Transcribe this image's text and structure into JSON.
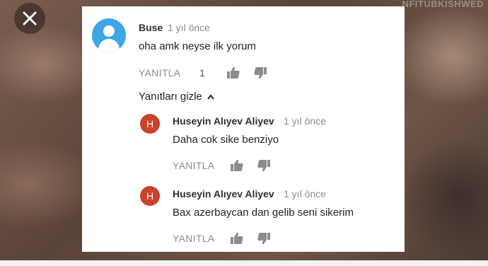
{
  "overlay": {
    "watermark_text": "NFITUBKISHWED"
  },
  "comment": {
    "author": "Buse",
    "time": "1 yıl önce",
    "text": "oha amk neyse ilk yorum",
    "reply_label": "YANITLA",
    "like_count": "1",
    "avatar_color": "#3ea6e6"
  },
  "hide_replies_label": "Yanıtları gizle",
  "replies": [
    {
      "avatar_letter": "H",
      "author": "Huseyin Alıyev Aliyev",
      "time": "1 yıl önce",
      "text": "Daha cok sike benziyo",
      "reply_label": "YANITLA"
    },
    {
      "avatar_letter": "H",
      "author": "Huseyin Alıyev Aliyev",
      "time": "1 yıl önce",
      "text": "Bax azerbaycan dan gelib seni  sikerim",
      "reply_label": "YANITLA"
    }
  ],
  "colors": {
    "reply_avatar": "#c8422c",
    "card_bg": "#ffffff",
    "muted_text": "#8c8c8c"
  }
}
